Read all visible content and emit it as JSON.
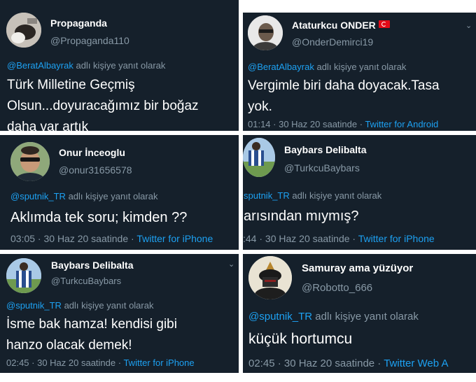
{
  "accent": "#1da1f2",
  "background": "#15202b",
  "reply_suffix": "adlı kişiye yanıt olarak",
  "tweets": [
    {
      "display_name": "Propaganda",
      "handle": "@Propaganda110",
      "reply_to": "@BeratAlbayrak",
      "text_lines": [
        "Türk Milletine Geçmiş",
        "Olsun...doyuracağımız bir boğaz",
        "daha var artık"
      ],
      "time": "",
      "source": ""
    },
    {
      "display_name": "Ataturkcu ONDER",
      "flag_icon": "turkey-flag-icon",
      "handle": "@OnderDemirci19",
      "reply_to": "@BeratAlbayrak",
      "text_lines": [
        "Vergimle biri daha doyacak.Tasa",
        "yok."
      ],
      "time": "01:14 · 30 Haz 20 saatinde ·",
      "source": "Twitter for Android"
    },
    {
      "display_name": "Onur İnceoglu",
      "handle": "@onur31656578",
      "reply_to": "@sputnik_TR",
      "text_lines": [
        "Aklımda tek soru;  kimden ??"
      ],
      "time": "03:05 · 30 Haz 20 saatinde ·",
      "source": "Twitter for iPhone"
    },
    {
      "display_name": "Baybars Delibalta",
      "handle": "@TurkcuBaybars",
      "reply_to": "sputnik_TR",
      "text_lines": [
        "arısından mıymış?"
      ],
      "time": ":44 · 30 Haz 20 saatinde ·",
      "source": "Twitter for iPhone"
    },
    {
      "display_name": "Baybars Delibalta",
      "handle": "@TurkcuBaybars",
      "reply_to": "@sputnik_TR",
      "text_lines": [
        "İsme bak hamza! kendisi gibi",
        "hanzo olacak demek!"
      ],
      "time": "02:45 · 30 Haz 20 saatinde ·",
      "source": "Twitter for iPhone"
    },
    {
      "display_name": "Samuray ama yüzüyor",
      "handle": "@Robotto_666",
      "reply_to": "@sputnik_TR",
      "text_lines": [
        "küçük hortumcu"
      ],
      "time": "02:45 · 30 Haz 20 saatinde ·",
      "source": "Twitter Web A"
    }
  ]
}
